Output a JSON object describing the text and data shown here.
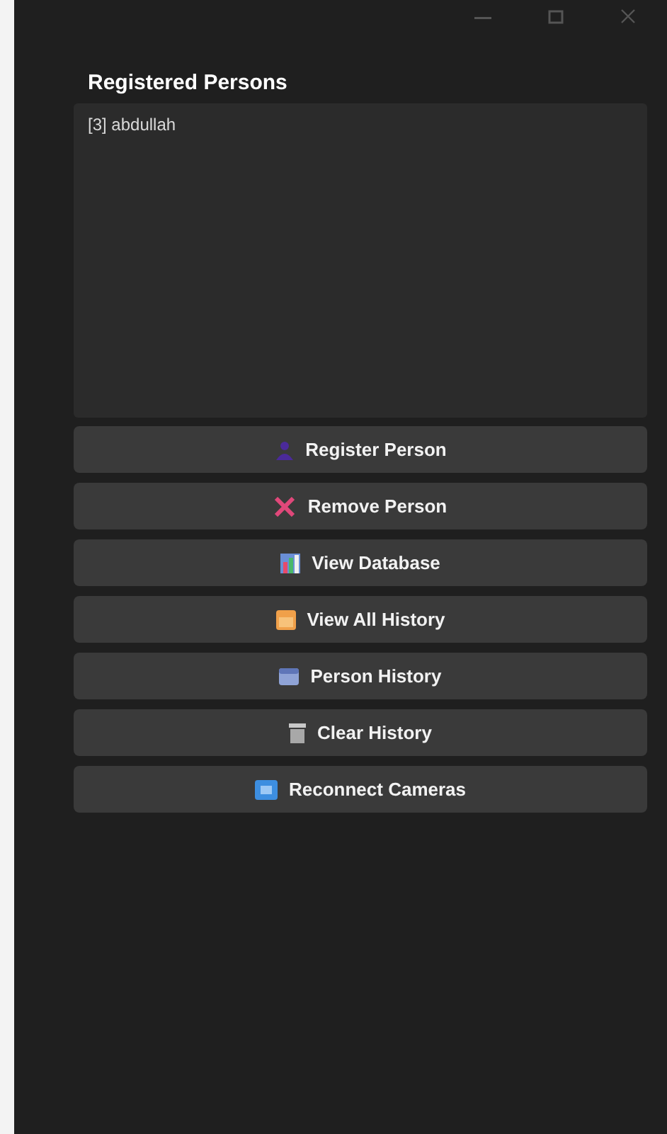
{
  "panel": {
    "title": "Registered Persons"
  },
  "persons": [
    {
      "label": "[3] abdullah"
    }
  ],
  "buttons": [
    {
      "label": "Register Person",
      "kind": "person"
    },
    {
      "label": "Remove Person",
      "kind": "cross"
    },
    {
      "label": "View Database",
      "kind": "database"
    },
    {
      "label": "View All History",
      "kind": "history"
    },
    {
      "label": "Person History",
      "kind": "card"
    },
    {
      "label": "Clear History",
      "kind": "trash"
    },
    {
      "label": "Reconnect Cameras",
      "kind": "camera"
    }
  ]
}
